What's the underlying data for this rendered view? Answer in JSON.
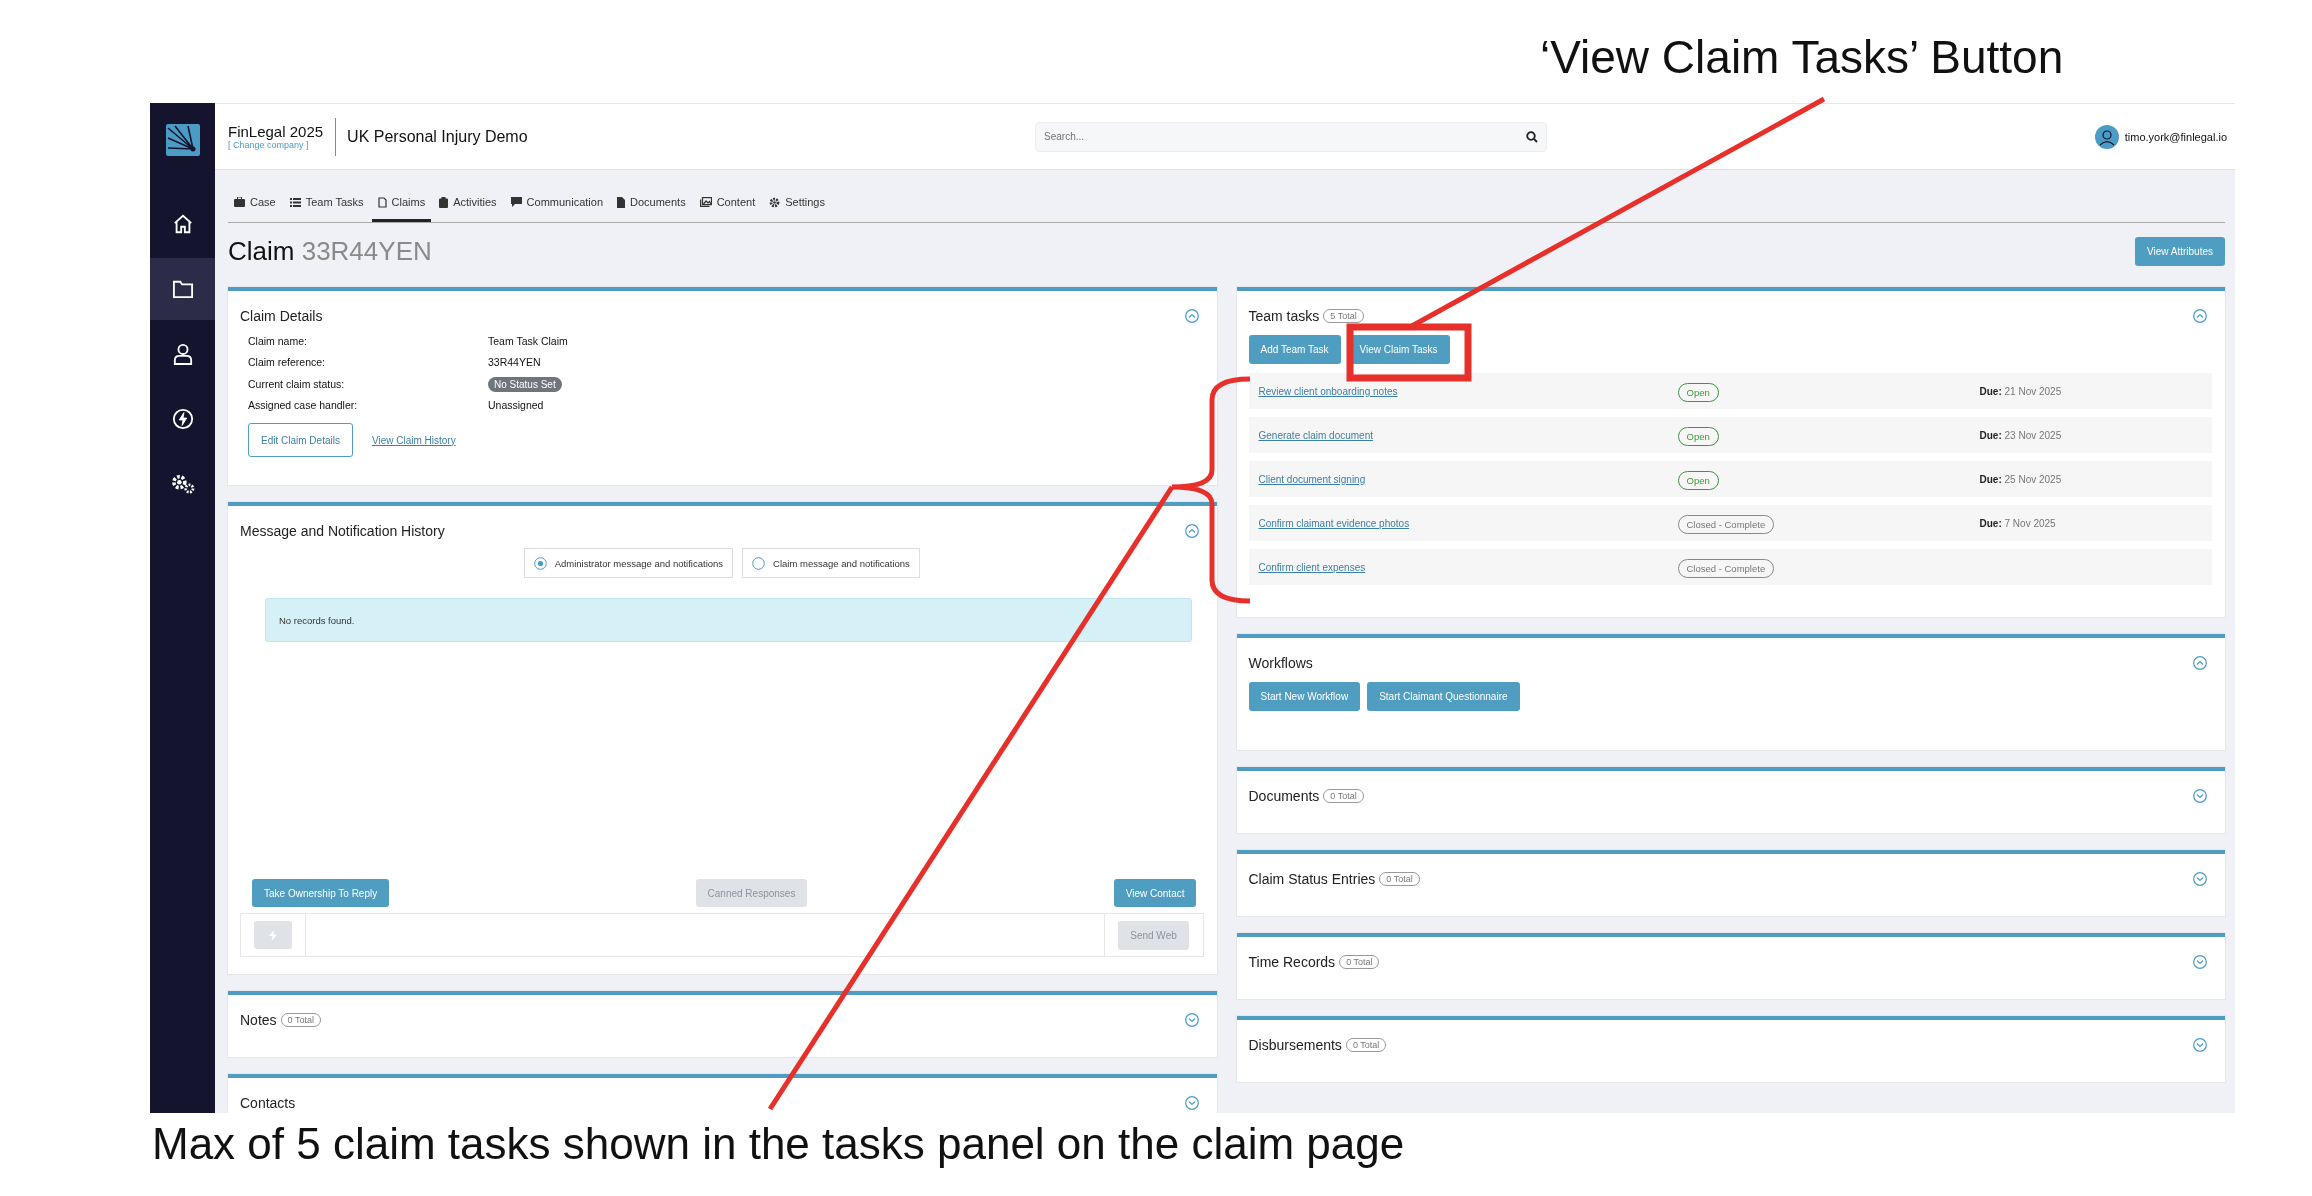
{
  "annotations": {
    "title": "‘View Claim Tasks’ Button",
    "caption": "Max of 5 claim tasks shown in the tasks panel on the claim page"
  },
  "sidebar": {
    "items": [
      {
        "kind": "home",
        "selected": false
      },
      {
        "kind": "folder",
        "selected": true
      },
      {
        "kind": "user",
        "selected": false
      },
      {
        "kind": "bolt",
        "selected": false
      },
      {
        "kind": "gears",
        "selected": false
      }
    ]
  },
  "header": {
    "org": "FinLegal 2025",
    "change_company": "[ Change company ]",
    "project": "UK Personal Injury Demo",
    "search": {
      "placeholder": "Search..."
    },
    "user": "timo.york@finlegal.io"
  },
  "tabs": [
    {
      "label": "Case",
      "kind": "briefcase",
      "selected": false
    },
    {
      "label": "Team Tasks",
      "kind": "list",
      "selected": false
    },
    {
      "label": "Claims",
      "kind": "doc",
      "selected": true
    },
    {
      "label": "Activities",
      "kind": "clipboard",
      "selected": false
    },
    {
      "label": "Communication",
      "kind": "comment",
      "selected": false
    },
    {
      "label": "Documents",
      "kind": "file",
      "selected": false
    },
    {
      "label": "Content",
      "kind": "images",
      "selected": false
    },
    {
      "label": "Settings",
      "kind": "gear",
      "selected": false
    }
  ],
  "page_title": {
    "label": "Claim",
    "reference": "33R44YEN"
  },
  "view_attributes_button": "View Attributes",
  "claim_details": {
    "title": "Claim Details",
    "expanded": true,
    "fields": [
      {
        "label": "Claim name:",
        "value": "Team Task Claim",
        "kind": "text"
      },
      {
        "label": "Claim reference:",
        "value": "33R44YEN",
        "kind": "text"
      },
      {
        "label": "Current claim status:",
        "value": "No Status Set",
        "kind": "badge"
      },
      {
        "label": "Assigned case handler:",
        "value": "Unassigned",
        "kind": "text"
      }
    ],
    "edit_button": "Edit Claim Details",
    "history_link": "View Claim History"
  },
  "messages": {
    "title": "Message and Notification History",
    "expanded": true,
    "options": [
      {
        "label": "Administrator message and notifications",
        "selected": true
      },
      {
        "label": "Claim message and notifications",
        "selected": false
      }
    ],
    "empty_message": "No records found.",
    "take_ownership_button": "Take Ownership To Reply",
    "canned_responses_button": {
      "label": "Canned Responses",
      "disabled": true
    },
    "view_contact_button": "View Contact",
    "send_button": {
      "label": "Send Web",
      "disabled": true
    }
  },
  "left_panels": [
    {
      "title": "Notes",
      "count": "0 Total",
      "expanded": false
    },
    {
      "title": "Contacts",
      "expanded": false
    }
  ],
  "team_tasks": {
    "title": "Team tasks",
    "count": "5 Total",
    "expanded": true,
    "buttons": [
      "Add Team Task",
      "View Claim Tasks"
    ],
    "rows": [
      {
        "name": "Review client onboarding notes",
        "status": "Open",
        "closed": false,
        "due_label": "Due:",
        "due": "21 Nov 2025"
      },
      {
        "name": "Generate claim document",
        "status": "Open",
        "closed": false,
        "due_label": "Due:",
        "due": "23 Nov 2025"
      },
      {
        "name": "Client document signing",
        "status": "Open",
        "closed": false,
        "due_label": "Due:",
        "due": "25 Nov 2025"
      },
      {
        "name": "Confirm claimant evidence photos",
        "status": "Closed - Complete",
        "closed": true,
        "due_label": "Due:",
        "due": "7 Nov 2025"
      },
      {
        "name": "Confirm client expenses",
        "status": "Closed - Complete",
        "closed": true
      }
    ]
  },
  "workflows": {
    "title": "Workflows",
    "expanded": true,
    "buttons": [
      "Start New Workflow",
      "Start Claimant Questionnaire"
    ]
  },
  "right_panels": [
    {
      "title": "Documents",
      "count": "0 Total",
      "expanded": false
    },
    {
      "title": "Claim Status Entries",
      "count": "0 Total",
      "expanded": false
    },
    {
      "title": "Time Records",
      "count": "0 Total",
      "expanded": false
    },
    {
      "title": "Disbursements",
      "count": "0 Total",
      "expanded": false
    }
  ]
}
